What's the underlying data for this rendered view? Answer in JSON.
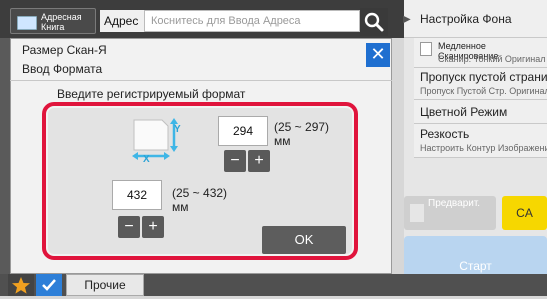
{
  "header": {
    "address_book_label": "Адресная Книга",
    "address_label": "Адрес",
    "address_placeholder": "Коснитесь для Ввода Адреса"
  },
  "dialog": {
    "title_line1": "Размер Скан-Я",
    "title_line2": "Ввод Формата",
    "prompt": "Введите регистрируемый формат",
    "y_value": "294",
    "y_range": "(25 ~ 297)",
    "y_unit": "мм",
    "x_value": "432",
    "x_range": "(25 ~ 432)",
    "x_unit": "мм",
    "minus": "−",
    "plus": "+",
    "ok_label": "OK",
    "axis_y": "Y",
    "axis_x": "X"
  },
  "right_panel": {
    "title": "Настройка Фона",
    "items": [
      {
        "main": "Медленное Сканирование",
        "sub": "Сканир. Тонкий Оригинал"
      },
      {
        "main": "Пропуск пустой страници",
        "sub": "Пропуск Пустой Стр. Оригинала"
      },
      {
        "main": "Цветной Режим",
        "sub": ""
      },
      {
        "main": "Резкость",
        "sub": "Настроить Контур Изображения"
      }
    ],
    "preview_label": "Предварит.",
    "ca_label": "CA",
    "start_label": "Старт"
  },
  "bottom": {
    "more_label": "Прочие"
  },
  "colors": {
    "accent_blue": "#1f6fd0",
    "highlight_red": "#e0143c",
    "ca_yellow": "#f6d700"
  }
}
